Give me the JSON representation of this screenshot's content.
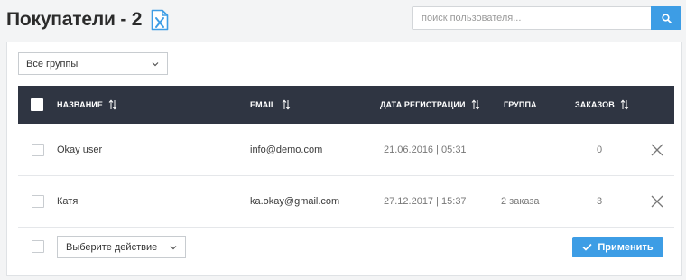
{
  "header": {
    "title": "Покупатели - 2",
    "export_icon": "excel-file-icon"
  },
  "search": {
    "placeholder": "поиск пользователя...",
    "icon": "search-icon"
  },
  "filter": {
    "group_select_value": "Все группы"
  },
  "table": {
    "columns": [
      {
        "key": "name",
        "label": "НАЗВАНИЕ",
        "sortable": true
      },
      {
        "key": "email",
        "label": "EMAIL",
        "sortable": true
      },
      {
        "key": "registered",
        "label": "ДАТА РЕГИСТРАЦИИ",
        "sortable": true
      },
      {
        "key": "group",
        "label": "ГРУППА",
        "sortable": false
      },
      {
        "key": "orders",
        "label": "ЗАКАЗОВ",
        "sortable": true
      }
    ],
    "rows": [
      {
        "name": "Okay user",
        "email": "info@demo.com",
        "registered": "21.06.2016 | 05:31",
        "group": "",
        "orders": "0"
      },
      {
        "name": "Катя",
        "email": "ka.okay@gmail.com",
        "registered": "27.12.2017 | 15:37",
        "group": "2 заказа",
        "orders": "3"
      }
    ]
  },
  "footer": {
    "action_select_value": "Выберите действие",
    "apply_label": "Применить"
  },
  "colors": {
    "accent": "#3d9de5",
    "header_bg": "#2f3542",
    "excel_icon": "#3d9de5"
  }
}
